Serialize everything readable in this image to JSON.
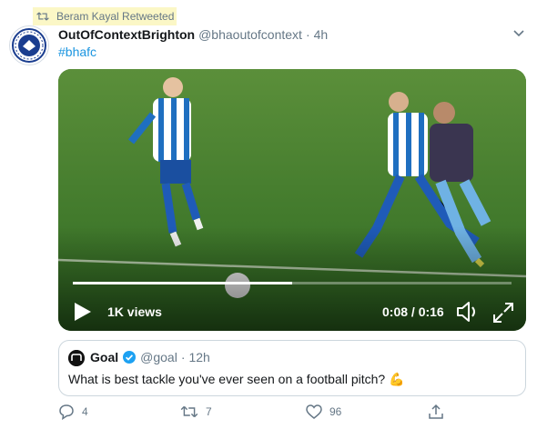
{
  "retweet_context": {
    "text": "Beram Kayal Retweeted"
  },
  "tweet": {
    "display_name": "OutOfContextBrighton",
    "handle": "@bhaoutofcontext",
    "separator": "·",
    "time": "4h",
    "text": "#bhafc"
  },
  "video": {
    "views": "1K views",
    "timecode": "0:08 / 0:16",
    "progress": 0.5
  },
  "quoted_tweet": {
    "display_name": "Goal",
    "handle": "@goal",
    "separator": "·",
    "time": "12h",
    "text": "What is best tackle you've ever seen on a football pitch?",
    "emoji": "💪"
  },
  "actions": {
    "replies": "4",
    "retweets": "7",
    "likes": "96"
  },
  "colors": {
    "accent": "#1b95e0",
    "muted": "#657786",
    "highlight": "#fbf7c6"
  }
}
